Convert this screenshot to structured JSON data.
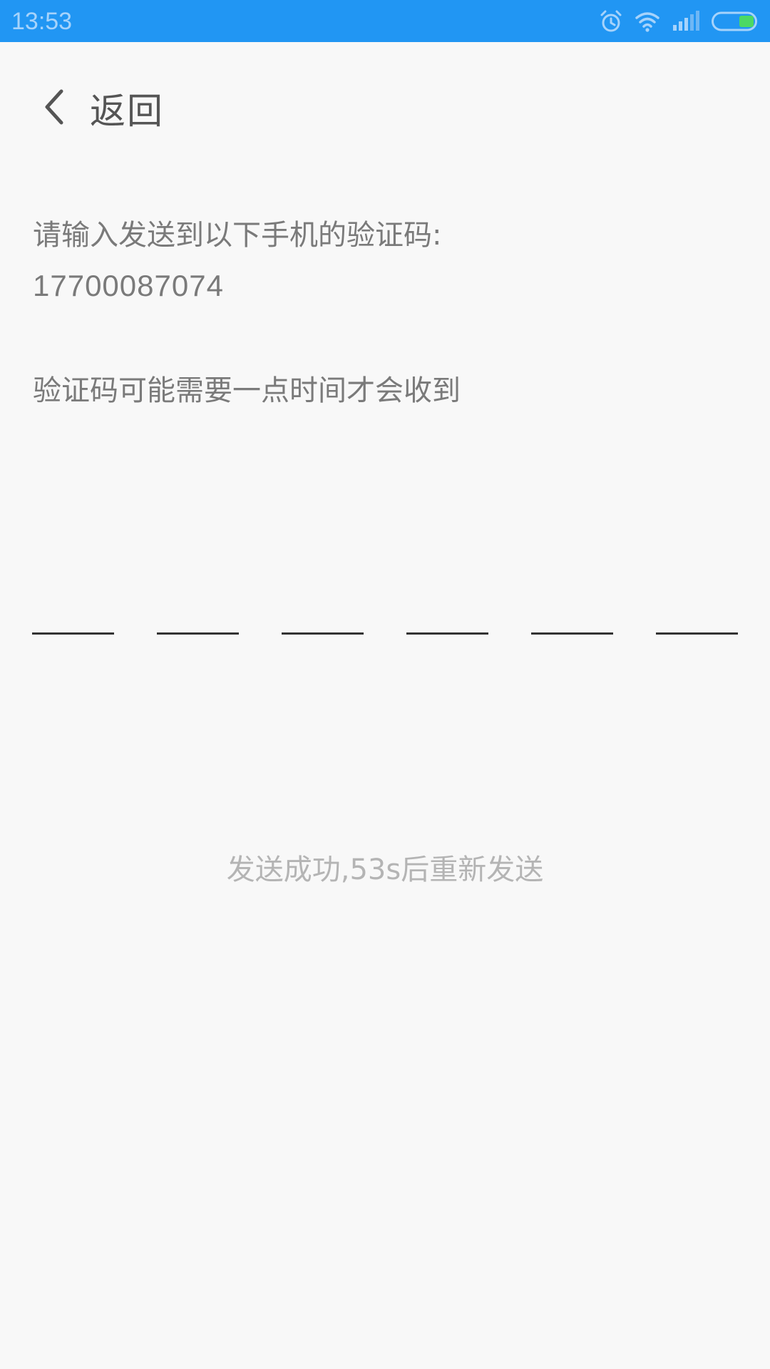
{
  "status_bar": {
    "time": "13:53",
    "icons": [
      "alarm-icon",
      "wifi-icon",
      "signal-icon",
      "battery-icon"
    ],
    "background_color": "#2196f3"
  },
  "nav": {
    "back_label": "返回",
    "back_icon": "chevron-left-icon"
  },
  "verification": {
    "prompt": "请输入发送到以下手机的验证码:",
    "phone_number": "17700087074",
    "hint": "验证码可能需要一点时间才会收到",
    "code_length": 6,
    "code_values": [
      "",
      "",
      "",
      "",
      "",
      ""
    ]
  },
  "resend": {
    "status_text": "发送成功,53s后重新发送"
  }
}
